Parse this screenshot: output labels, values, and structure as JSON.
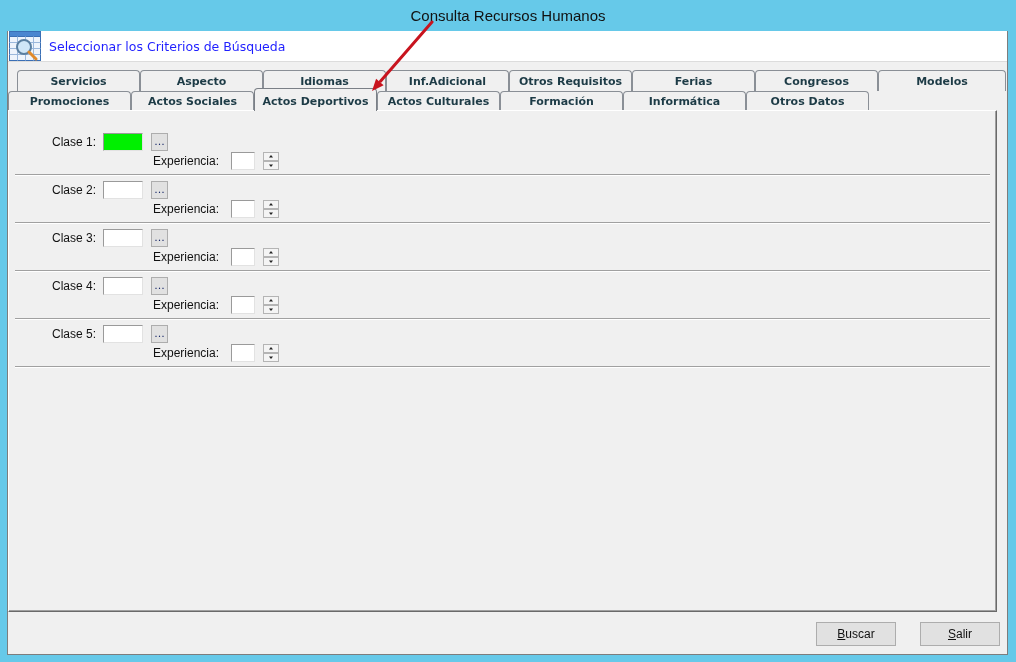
{
  "caption": "Consulta Recursos Humanos",
  "header": {
    "title": "Seleccionar los Criterios de Búsqueda"
  },
  "tab_rows": [
    {
      "tabs": [
        {
          "label": "Servicios",
          "selected": false
        },
        {
          "label": "Aspecto",
          "selected": false
        },
        {
          "label": "Idiomas",
          "selected": false
        },
        {
          "label": "Inf.Adicional",
          "selected": false
        },
        {
          "label": "Otros Requisitos",
          "selected": false
        },
        {
          "label": "Ferias",
          "selected": false
        },
        {
          "label": "Congresos",
          "selected": false
        },
        {
          "label": "Modelos",
          "selected": false
        }
      ]
    },
    {
      "tabs": [
        {
          "label": "Promociones",
          "selected": false
        },
        {
          "label": "Actos Sociales",
          "selected": false
        },
        {
          "label": "Actos Deportivos",
          "selected": true
        },
        {
          "label": "Actos Culturales",
          "selected": false
        },
        {
          "label": "Formación",
          "selected": false
        },
        {
          "label": "Informática",
          "selected": false
        },
        {
          "label": "Otros Datos",
          "selected": false
        }
      ]
    }
  ],
  "clases": [
    {
      "label": "Clase 1:",
      "highlighted": true,
      "button": "...",
      "experience_label": "Experiencia:"
    },
    {
      "label": "Clase 2:",
      "highlighted": false,
      "button": "...",
      "experience_label": "Experiencia:"
    },
    {
      "label": "Clase 3:",
      "highlighted": false,
      "button": "...",
      "experience_label": "Experiencia:"
    },
    {
      "label": "Clase 4:",
      "highlighted": false,
      "button": "...",
      "experience_label": "Experiencia:"
    },
    {
      "label": "Clase 5:",
      "highlighted": false,
      "button": "...",
      "experience_label": "Experiencia:"
    }
  ],
  "buttons": [
    {
      "label": "Buscar",
      "mnemonic": true
    },
    {
      "label": "Salir",
      "mnemonic": true
    }
  ]
}
